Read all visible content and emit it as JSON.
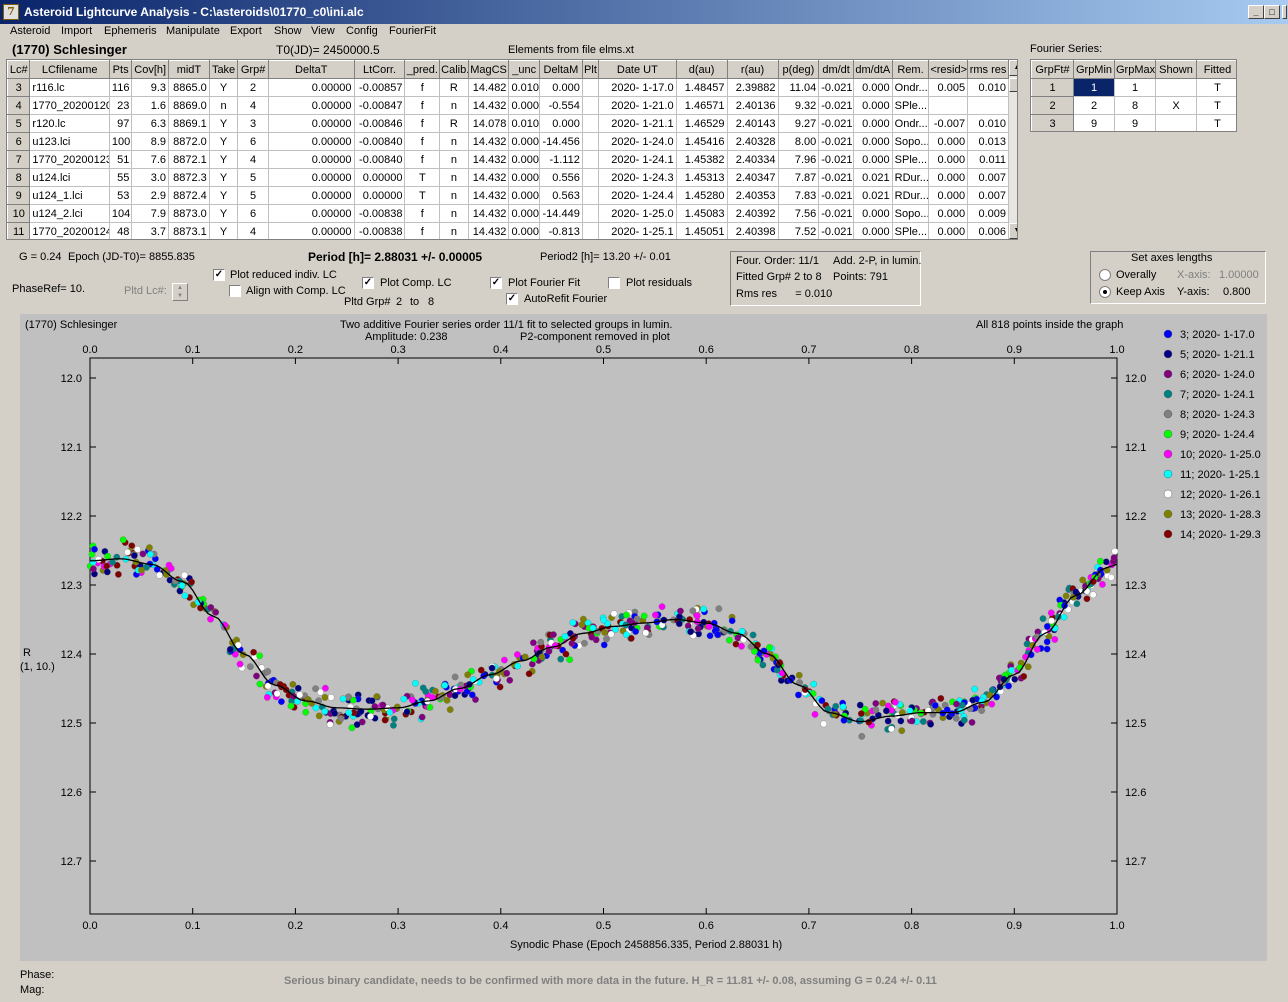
{
  "window": {
    "app_icon": "7",
    "title": "Asteroid Lightcurve Analysis - C:\\asteroids\\01770_c0\\ini.alc",
    "minimize": "_",
    "maximize": "□",
    "close": "X"
  },
  "menu": [
    "Asteroid",
    "Import",
    "Ephemeris",
    "Manipulate",
    "Export",
    "Show",
    "View",
    "Config",
    "FourierFit"
  ],
  "header": {
    "asteroid": "(1770) Schlesinger",
    "t0": "T0(JD)= 2450000.5",
    "elements": "Elements from file elms.xt",
    "fourier_series_label": "Fourier Series:"
  },
  "lc_table": {
    "columns": [
      "Lc#",
      "LCfilename",
      "Pts",
      "Cov[h]",
      "midT",
      "Take",
      "Grp#",
      "DeltaT",
      "LtCorr.",
      "_pred.",
      "Calib.",
      "MagCS",
      "_unc",
      "DeltaM",
      "Plt",
      "Date UT",
      "d(au)",
      "r(au)",
      "p(deg)",
      "dm/dt",
      "dm/dtA",
      "Rem.",
      "<resid>",
      "rms res"
    ],
    "rows": [
      [
        "3",
        "r116.lc",
        "116",
        "9.3",
        "8865.0",
        "Y",
        "2",
        "0.00000",
        "-0.00857",
        "f",
        "R",
        "14.482",
        "0.010",
        "0.000",
        "",
        "2020- 1-17.0",
        "1.48457",
        "2.39882",
        "11.04",
        "-0.021",
        "0.000",
        "Ondr...",
        "0.005",
        "0.010"
      ],
      [
        "4",
        "1770_20200120",
        "23",
        "1.6",
        "8869.0",
        "n",
        "4",
        "0.00000",
        "-0.00847",
        "f",
        "n",
        "14.432",
        "0.000",
        "-0.554",
        "",
        "2020- 1-21.0",
        "1.46571",
        "2.40136",
        "9.32",
        "-0.021",
        "0.000",
        "SPle...",
        "",
        ""
      ],
      [
        "5",
        "r120.lc",
        "97",
        "6.3",
        "8869.1",
        "Y",
        "3",
        "0.00000",
        "-0.00846",
        "f",
        "R",
        "14.078",
        "0.010",
        "0.000",
        "",
        "2020- 1-21.1",
        "1.46529",
        "2.40143",
        "9.27",
        "-0.021",
        "0.000",
        "Ondr...",
        "-0.007",
        "0.010"
      ],
      [
        "6",
        "u123.lci",
        "100",
        "8.9",
        "8872.0",
        "Y",
        "6",
        "0.00000",
        "-0.00840",
        "f",
        "n",
        "14.432",
        "0.000",
        "-14.456",
        "",
        "2020- 1-24.0",
        "1.45416",
        "2.40328",
        "8.00",
        "-0.021",
        "0.000",
        "Sopo...",
        "0.000",
        "0.013"
      ],
      [
        "7",
        "1770_20200123",
        "51",
        "7.6",
        "8872.1",
        "Y",
        "4",
        "0.00000",
        "-0.00840",
        "f",
        "n",
        "14.432",
        "0.000",
        "-1.112",
        "",
        "2020- 1-24.1",
        "1.45382",
        "2.40334",
        "7.96",
        "-0.021",
        "0.000",
        "SPle...",
        "0.000",
        "0.011"
      ],
      [
        "8",
        "u124.lci",
        "55",
        "3.0",
        "8872.3",
        "Y",
        "5",
        "0.00000",
        "0.00000",
        "T",
        "n",
        "14.432",
        "0.000",
        "0.556",
        "",
        "2020- 1-24.3",
        "1.45313",
        "2.40347",
        "7.87",
        "-0.021",
        "0.021",
        "RDur...",
        "0.000",
        "0.007"
      ],
      [
        "9",
        "u124_1.lci",
        "53",
        "2.9",
        "8872.4",
        "Y",
        "5",
        "0.00000",
        "0.00000",
        "T",
        "n",
        "14.432",
        "0.000",
        "0.563",
        "",
        "2020- 1-24.4",
        "1.45280",
        "2.40353",
        "7.83",
        "-0.021",
        "0.021",
        "RDur...",
        "0.000",
        "0.007"
      ],
      [
        "10",
        "u124_2.lci",
        "104",
        "7.9",
        "8873.0",
        "Y",
        "6",
        "0.00000",
        "-0.00838",
        "f",
        "n",
        "14.432",
        "0.000",
        "-14.449",
        "",
        "2020- 1-25.0",
        "1.45083",
        "2.40392",
        "7.56",
        "-0.021",
        "0.000",
        "Sopo...",
        "0.000",
        "0.009"
      ],
      [
        "11",
        "1770_20200124",
        "48",
        "3.7",
        "8873.1",
        "Y",
        "4",
        "0.00000",
        "-0.00838",
        "f",
        "n",
        "14.432",
        "0.000",
        "-0.813",
        "",
        "2020- 1-25.1",
        "1.45051",
        "2.40398",
        "7.52",
        "-0.021",
        "0.000",
        "SPle...",
        "0.000",
        "0.006"
      ]
    ]
  },
  "fourier_table": {
    "columns": [
      "GrpFt#",
      "GrpMin",
      "GrpMax",
      "Shown",
      "Fitted"
    ],
    "rows": [
      [
        "1",
        "1",
        "1",
        "",
        "T"
      ],
      [
        "2",
        "2",
        "8",
        "X",
        "T"
      ],
      [
        "3",
        "9",
        "9",
        "",
        "T"
      ]
    ]
  },
  "controls": {
    "g": "G = 0.24",
    "epoch": "Epoch (JD-T0)= 8855.835",
    "phaseref": "PhaseRef= 10.",
    "pltd_lc": "Pltd Lc#:",
    "plot_reduced": "Plot reduced indiv. LC",
    "align": "Align with Comp. LC",
    "plot_comp": "Plot Comp. LC",
    "pltd_grp": "Pltd Grp#",
    "grp_from": "2",
    "grp_to_label": "to",
    "grp_to": "8",
    "period": "Period [h]= 2.88031 +/- 0.00005",
    "plot_fourier": "Plot Fourier Fit",
    "autorefit": "AutoRefit Fourier",
    "plot_residuals": "Plot residuals",
    "period2": "Period2 [h]= 13.20 +/- 0.01",
    "check_mark": "✓"
  },
  "fit_info": {
    "order": "Four. Order: 11/1",
    "add": "Add. 2-P, in lumin.",
    "fitted": "Fitted Grp# 2 to 8",
    "points": "Points: 791",
    "rms": "Rms res      = 0.010"
  },
  "axes_box": {
    "title": "Set axes lengths",
    "overally": "Overally",
    "keep": "Keep Axis",
    "x_label": "X-axis:",
    "x_val": "1.00000",
    "y_label": "Y-axis:",
    "y_val": "0.800"
  },
  "plot": {
    "name": "(1770) Schlesinger",
    "title": "Two additive Fourier series order 11/1 fit to selected groups in lumin.",
    "amplitude": "Amplitude: 0.238",
    "p2": "P2-component removed in plot",
    "points_note": "All 818 points inside the graph",
    "ylabel": "R",
    "ylabel2": "(1, 10.)",
    "xlabel": "Synodic Phase (Epoch 2458856.335, Period 2.88031 h)"
  },
  "chart_data": {
    "type": "scatter",
    "title": "Two additive Fourier series order 11/1 fit to selected groups in lumin.",
    "xlabel": "Synodic Phase (Epoch 2458856.335, Period 2.88031 h)",
    "ylabel": "R",
    "xlim": [
      0,
      1
    ],
    "ylim": [
      12.0,
      12.8
    ],
    "y_inverted": true,
    "x_ticks": [
      "0.0",
      "0.1",
      "0.2",
      "0.3",
      "0.4",
      "0.5",
      "0.6",
      "0.7",
      "0.8",
      "0.9",
      "1.0"
    ],
    "y_ticks": [
      "12.0",
      "12.1",
      "12.2",
      "12.3",
      "12.4",
      "12.5",
      "12.6",
      "12.7"
    ],
    "fit_curve": {
      "x": [
        0.0,
        0.03,
        0.06,
        0.09,
        0.12,
        0.15,
        0.18,
        0.21,
        0.24,
        0.27,
        0.3,
        0.33,
        0.36,
        0.39,
        0.42,
        0.45,
        0.48,
        0.51,
        0.54,
        0.57,
        0.6,
        0.63,
        0.66,
        0.69,
        0.72,
        0.75,
        0.78,
        0.81,
        0.84,
        0.87,
        0.9,
        0.93,
        0.96,
        0.99,
        1.0
      ],
      "y": [
        12.265,
        12.262,
        12.27,
        12.295,
        12.345,
        12.4,
        12.445,
        12.468,
        12.478,
        12.48,
        12.478,
        12.468,
        12.45,
        12.43,
        12.41,
        12.39,
        12.37,
        12.36,
        12.355,
        12.35,
        12.355,
        12.37,
        12.4,
        12.445,
        12.485,
        12.498,
        12.49,
        12.485,
        12.485,
        12.47,
        12.43,
        12.37,
        12.315,
        12.275,
        12.27
      ]
    },
    "series": [
      {
        "name": "3; 2020- 1-17.0",
        "color": "#0000ff"
      },
      {
        "name": "5; 2020- 1-21.1",
        "color": "#000080"
      },
      {
        "name": "6; 2020- 1-24.0",
        "color": "#800080"
      },
      {
        "name": "7; 2020- 1-24.1",
        "color": "#008080"
      },
      {
        "name": "8; 2020- 1-24.3",
        "color": "#808080"
      },
      {
        "name": "9; 2020- 1-24.4",
        "color": "#00ff00"
      },
      {
        "name": "10; 2020- 1-25.0",
        "color": "#ff00ff"
      },
      {
        "name": "11; 2020- 1-25.1",
        "color": "#00ffff"
      },
      {
        "name": "12; 2020- 1-26.1",
        "color": "#ffffff"
      },
      {
        "name": "13; 2020- 1-28.3",
        "color": "#808000"
      },
      {
        "name": "14; 2020- 1-29.3",
        "color": "#800000"
      }
    ],
    "grid": false,
    "legend": "right"
  },
  "status": {
    "phase": "Phase:",
    "mag": "Mag:",
    "note": "Serious binary candidate, needs to be confirmed with more data in the future.   H_R = 11.81 +/- 0.08, assuming G = 0.24 +/- 0.11"
  }
}
